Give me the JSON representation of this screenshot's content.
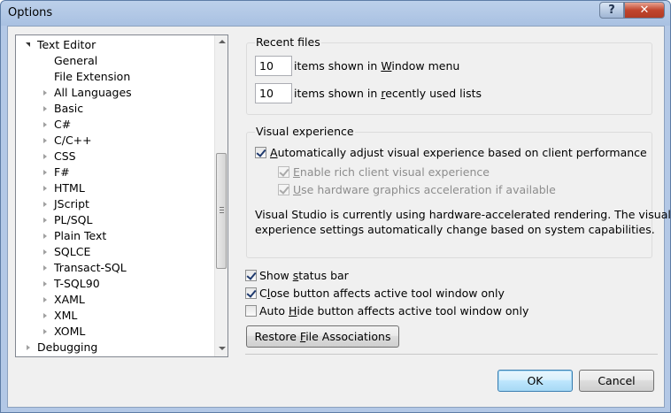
{
  "window": {
    "title": "Options",
    "help_label": "?",
    "close_label": "✕"
  },
  "tree": {
    "items": [
      {
        "label": "Text Editor",
        "expanded": true,
        "has_children": true
      },
      {
        "label": "General",
        "has_children": false
      },
      {
        "label": "File Extension",
        "has_children": false
      },
      {
        "label": "All Languages",
        "has_children": true
      },
      {
        "label": "Basic",
        "has_children": true
      },
      {
        "label": "C#",
        "has_children": true
      },
      {
        "label": "C/C++",
        "has_children": true
      },
      {
        "label": "CSS",
        "has_children": true
      },
      {
        "label": "F#",
        "has_children": true
      },
      {
        "label": "HTML",
        "has_children": true
      },
      {
        "label": "JScript",
        "has_children": true
      },
      {
        "label": "PL/SQL",
        "has_children": true
      },
      {
        "label": "Plain Text",
        "has_children": true
      },
      {
        "label": "SQLCE",
        "has_children": true
      },
      {
        "label": "Transact-SQL",
        "has_children": true
      },
      {
        "label": "T-SQL90",
        "has_children": true
      },
      {
        "label": "XAML",
        "has_children": true
      },
      {
        "label": "XML",
        "has_children": true
      },
      {
        "label": "XOML",
        "has_children": true
      },
      {
        "label": "Debugging",
        "has_children": true
      }
    ]
  },
  "recent_files": {
    "heading": "Recent files",
    "window_menu_value": "10",
    "window_menu_pre": "items shown in ",
    "window_menu_accel": "W",
    "window_menu_post": "indow menu",
    "recent_lists_value": "10",
    "recent_lists_pre": "items shown in ",
    "recent_lists_accel": "r",
    "recent_lists_post": "ecently used lists"
  },
  "visual_experience": {
    "heading": "Visual experience",
    "auto_adjust_accel": "A",
    "auto_adjust_rest": "utomatically adjust visual experience based on client performance",
    "auto_adjust_checked": true,
    "rich_client_accel": "E",
    "rich_client_rest": "nable rich client visual experience",
    "rich_client_checked": true,
    "hw_accel_accel": "U",
    "hw_accel_rest": "se hardware graphics acceleration if available",
    "hw_accel_checked": true,
    "info_line1": "Visual Studio is currently using hardware-accelerated rendering. The visual",
    "info_line2": "experience settings automatically change based on system capabilities."
  },
  "options": {
    "status_bar_pre": "Show ",
    "status_bar_accel": "s",
    "status_bar_post": "tatus bar",
    "status_bar_checked": true,
    "close_btn_pre": "C",
    "close_btn_accel": "l",
    "close_btn_post": "ose button affects active tool window only",
    "close_btn_checked": true,
    "auto_hide_pre": "Auto ",
    "auto_hide_accel": "H",
    "auto_hide_post": "ide button affects active tool window only",
    "auto_hide_checked": false,
    "restore_pre": "Restore ",
    "restore_accel": "F",
    "restore_post": "ile Associations"
  },
  "footer": {
    "ok_label": "OK",
    "cancel_label": "Cancel"
  }
}
